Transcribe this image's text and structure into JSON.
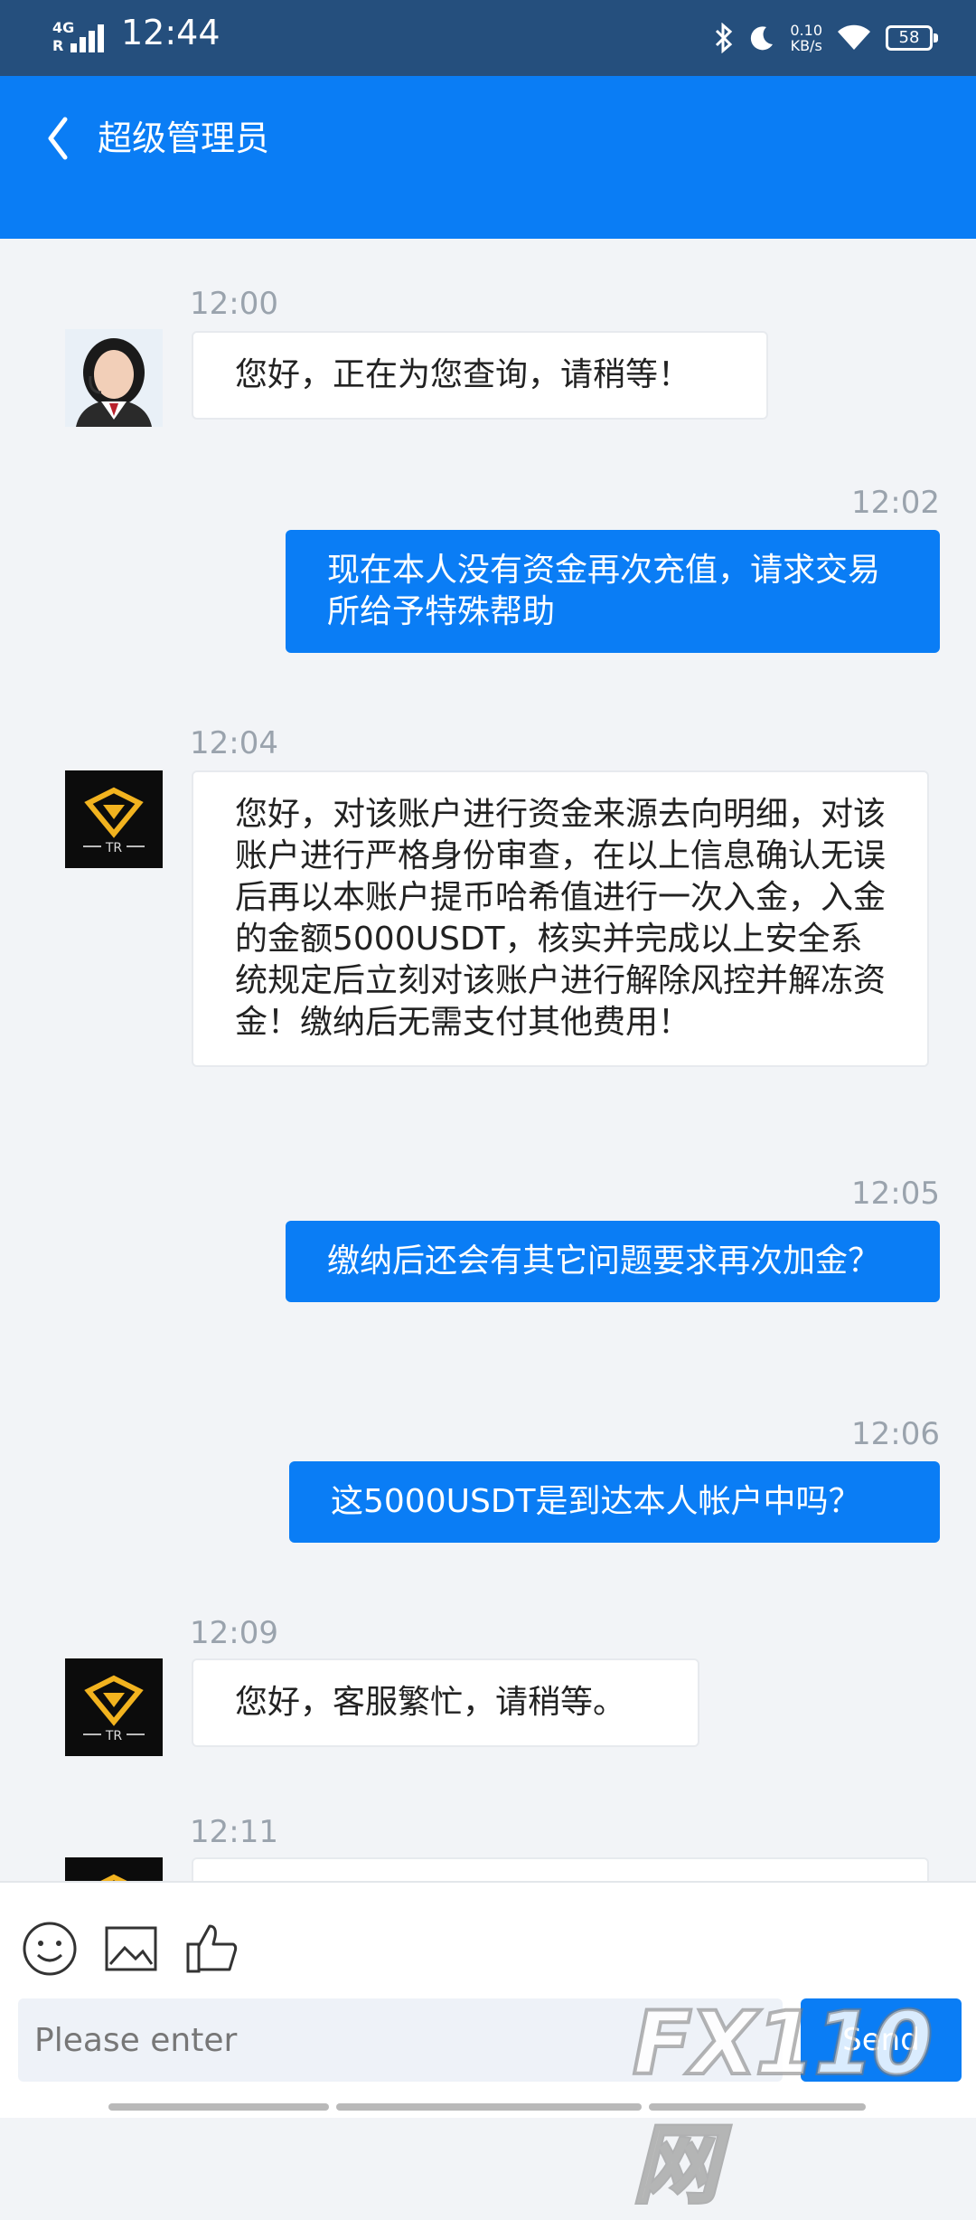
{
  "status_bar": {
    "network": "4G",
    "roaming": "R",
    "time": "12:44",
    "speed_value": "0.10",
    "speed_unit": "KB/s",
    "battery": "58"
  },
  "header": {
    "title": "超级管理员",
    "back_icon": "chevron-left-icon"
  },
  "messages": [
    {
      "side": "in",
      "time": "12:00",
      "avatar": "agent-photo",
      "text": "您好，正在为您查询，请稍等！"
    },
    {
      "side": "out",
      "time": "12:02",
      "text": "现在本人没有资金再次充值，请求交易所给予特殊帮助"
    },
    {
      "side": "in",
      "time": "12:04",
      "avatar": "tr-logo",
      "text": "您好，对该账户进行资金来源去向明细，对该账户进行严格身份审查，在以上信息确认无误后再以本账户提币哈希值进行一次入金，入金的金额5000USDT，核实并完成以上安全系统规定后立刻对该账户进行解除风控并解冻资金！缴纳后无需支付其他费用！"
    },
    {
      "side": "out",
      "time": "12:05",
      "text": "缴纳后还会有其它问题要求再次加金？"
    },
    {
      "side": "out",
      "time": "12:06",
      "text": "这5000USDT是到达本人帐户中吗？"
    },
    {
      "side": "in",
      "time": "12:09",
      "avatar": "tr-logo",
      "text": "您好，客服繁忙，请稍等。"
    },
    {
      "side": "in",
      "time": "12:11",
      "avatar": "tr-logo",
      "text": ""
    }
  ],
  "logo_text": "TR",
  "input": {
    "placeholder": "Please enter",
    "send_label": "Send"
  },
  "toolbar_icons": [
    "emoji-icon",
    "image-icon",
    "thumbs-up-icon"
  ],
  "watermark": "FX110网",
  "colors": {
    "primary": "#0a7df5",
    "status_bar": "#254f7d",
    "background": "#f2f4f7",
    "logo_gold": "#f2b31f"
  }
}
